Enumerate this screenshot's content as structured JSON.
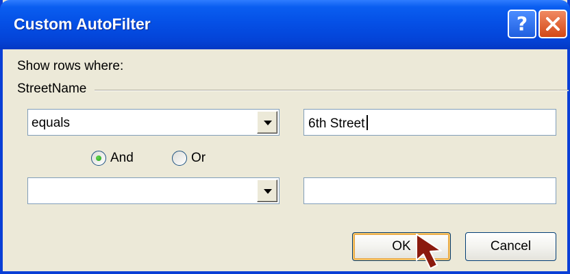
{
  "window": {
    "title": "Custom AutoFilter",
    "help_glyph": "?",
    "close_icon": "close-icon"
  },
  "dialog": {
    "prompt": "Show rows where:",
    "group_label": "StreetName",
    "condition1": {
      "operator": "equals",
      "value": "6th Street"
    },
    "logic": {
      "and_label": "And",
      "or_label": "Or",
      "selected": "And"
    },
    "condition2": {
      "operator": "",
      "value": ""
    },
    "buttons": {
      "ok_label": "OK",
      "cancel_label": "Cancel"
    }
  },
  "colors": {
    "titlebar": "#0550e6",
    "dialog_bg": "#ece9d8",
    "close_button": "#d34816",
    "radio_dot": "#21a121",
    "cursor_arrow": "#8b1a0e"
  }
}
